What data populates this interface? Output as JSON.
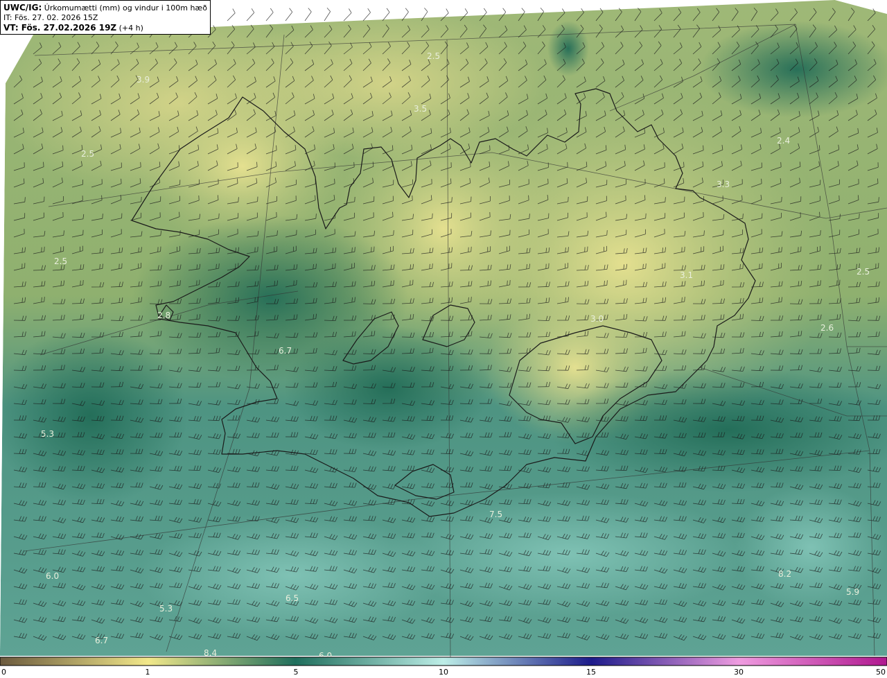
{
  "header": {
    "model": "UWC/IG:",
    "title": "Úrkomumætti (mm) og vindur i 100m hæð",
    "initial_time": "IT: Fös. 27. 02. 2026 15Z",
    "valid_prefix": "VT: Fös. 27.02.2026 19Z",
    "valid_offset": "(+4 h)"
  },
  "colorbar": {
    "ticks": [
      "0",
      "1",
      "5",
      "10",
      "15",
      "30",
      "50"
    ],
    "colors": [
      "#6b5a3e",
      "#b3a068",
      "#f2e88a",
      "#1f6e5c",
      "#bdeee7",
      "#1d1b8a",
      "#ef9ce0",
      "#b0188f"
    ]
  },
  "map_labels": [
    {
      "text": "2.5"
    },
    {
      "text": "3.9"
    },
    {
      "text": "3.5"
    },
    {
      "text": "2.4"
    },
    {
      "text": "3.3"
    },
    {
      "text": "2.5"
    },
    {
      "text": "2.5"
    },
    {
      "text": "3.1"
    },
    {
      "text": "2.5"
    },
    {
      "text": "2.8"
    },
    {
      "text": "3.0"
    },
    {
      "text": "2.6"
    },
    {
      "text": "6.7"
    },
    {
      "text": "5.3"
    },
    {
      "text": "7.5"
    },
    {
      "text": "6.0"
    },
    {
      "text": "8.2"
    },
    {
      "text": "5.9"
    },
    {
      "text": "6.5"
    },
    {
      "text": "5.3"
    },
    {
      "text": "6.7"
    },
    {
      "text": "8.4"
    },
    {
      "text": "6.0"
    }
  ],
  "colors": {
    "land_light": "#e6e190",
    "mid_green": "#9cb673",
    "dark_green": "#2e7a64",
    "sea_teal": "#5aa192",
    "coastline": "#1a1a1a",
    "barb": "#1a1a1a"
  }
}
